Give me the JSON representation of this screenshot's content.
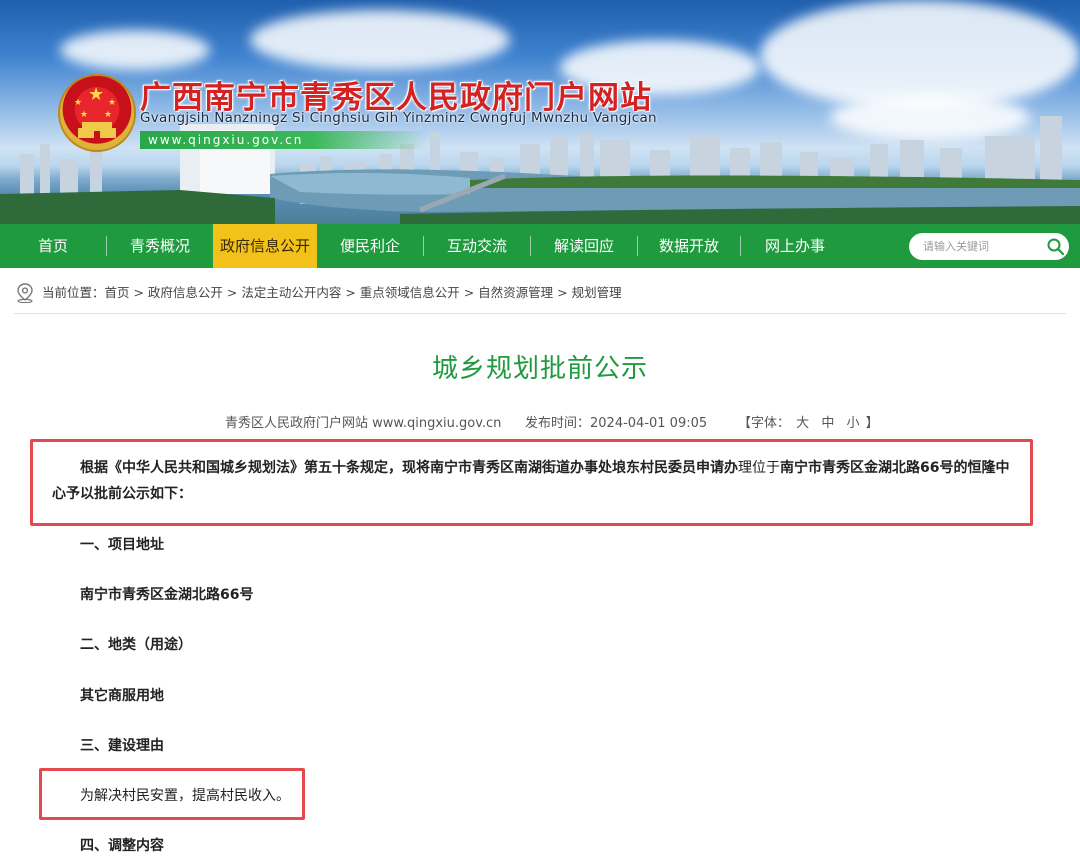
{
  "site": {
    "title": "广西南宁市青秀区人民政府门户网站",
    "subtitle": "Gvangjsih Nanzningz Si Cinghsiu Gih Yinzminz Cwngfuj Mwnzhu Vangjcan",
    "url": "www.qingxiu.gov.cn"
  },
  "nav": {
    "items": [
      "首页",
      "青秀概况",
      "政府信息公开",
      "便民利企",
      "互动交流",
      "解读回应",
      "数据开放",
      "网上办事"
    ],
    "active_index": 2
  },
  "search": {
    "placeholder": "请输入关键词"
  },
  "breadcrumb": {
    "text": "当前位置：首页 > 政府信息公开 > 法定主动公开内容 > 重点领域信息公开 > 自然资源管理 > 规划管理"
  },
  "article": {
    "title": "城乡规划批前公示",
    "source": "青秀区人民政府门户网站 www.qingxiu.gov.cn",
    "publish_time": "发布时间：2024-04-01 09:05",
    "font_label": "【字体：",
    "font_large": "大",
    "font_medium": "中",
    "font_small": "小",
    "font_end": "】",
    "intro_part1": "根据《中华人民共和国城乡规划法》第五十条规定，现将南宁市青秀区南湖街道办事处埌东村民委员申请办",
    "intro_part2": "理位于",
    "intro_part3": "南宁市青秀区金湖北路66号的恒隆中心予以批前公示如下：",
    "section1_heading": "一、项目地址",
    "section1_content": "南宁市青秀区金湖北路66号",
    "section2_heading": "二、地类（用途）",
    "section2_content": "其它商服用地",
    "section3_heading": "三、建设理由",
    "section3_content": "为解决村民安置，提高村民收入。",
    "section4_heading": "四、调整内容"
  },
  "colors": {
    "nav_green": "#1f9a3e",
    "nav_active": "#f2c21b",
    "title_green": "#1f9a3e",
    "site_title_red": "#d42222",
    "highlight_red": "#e24a4f"
  }
}
